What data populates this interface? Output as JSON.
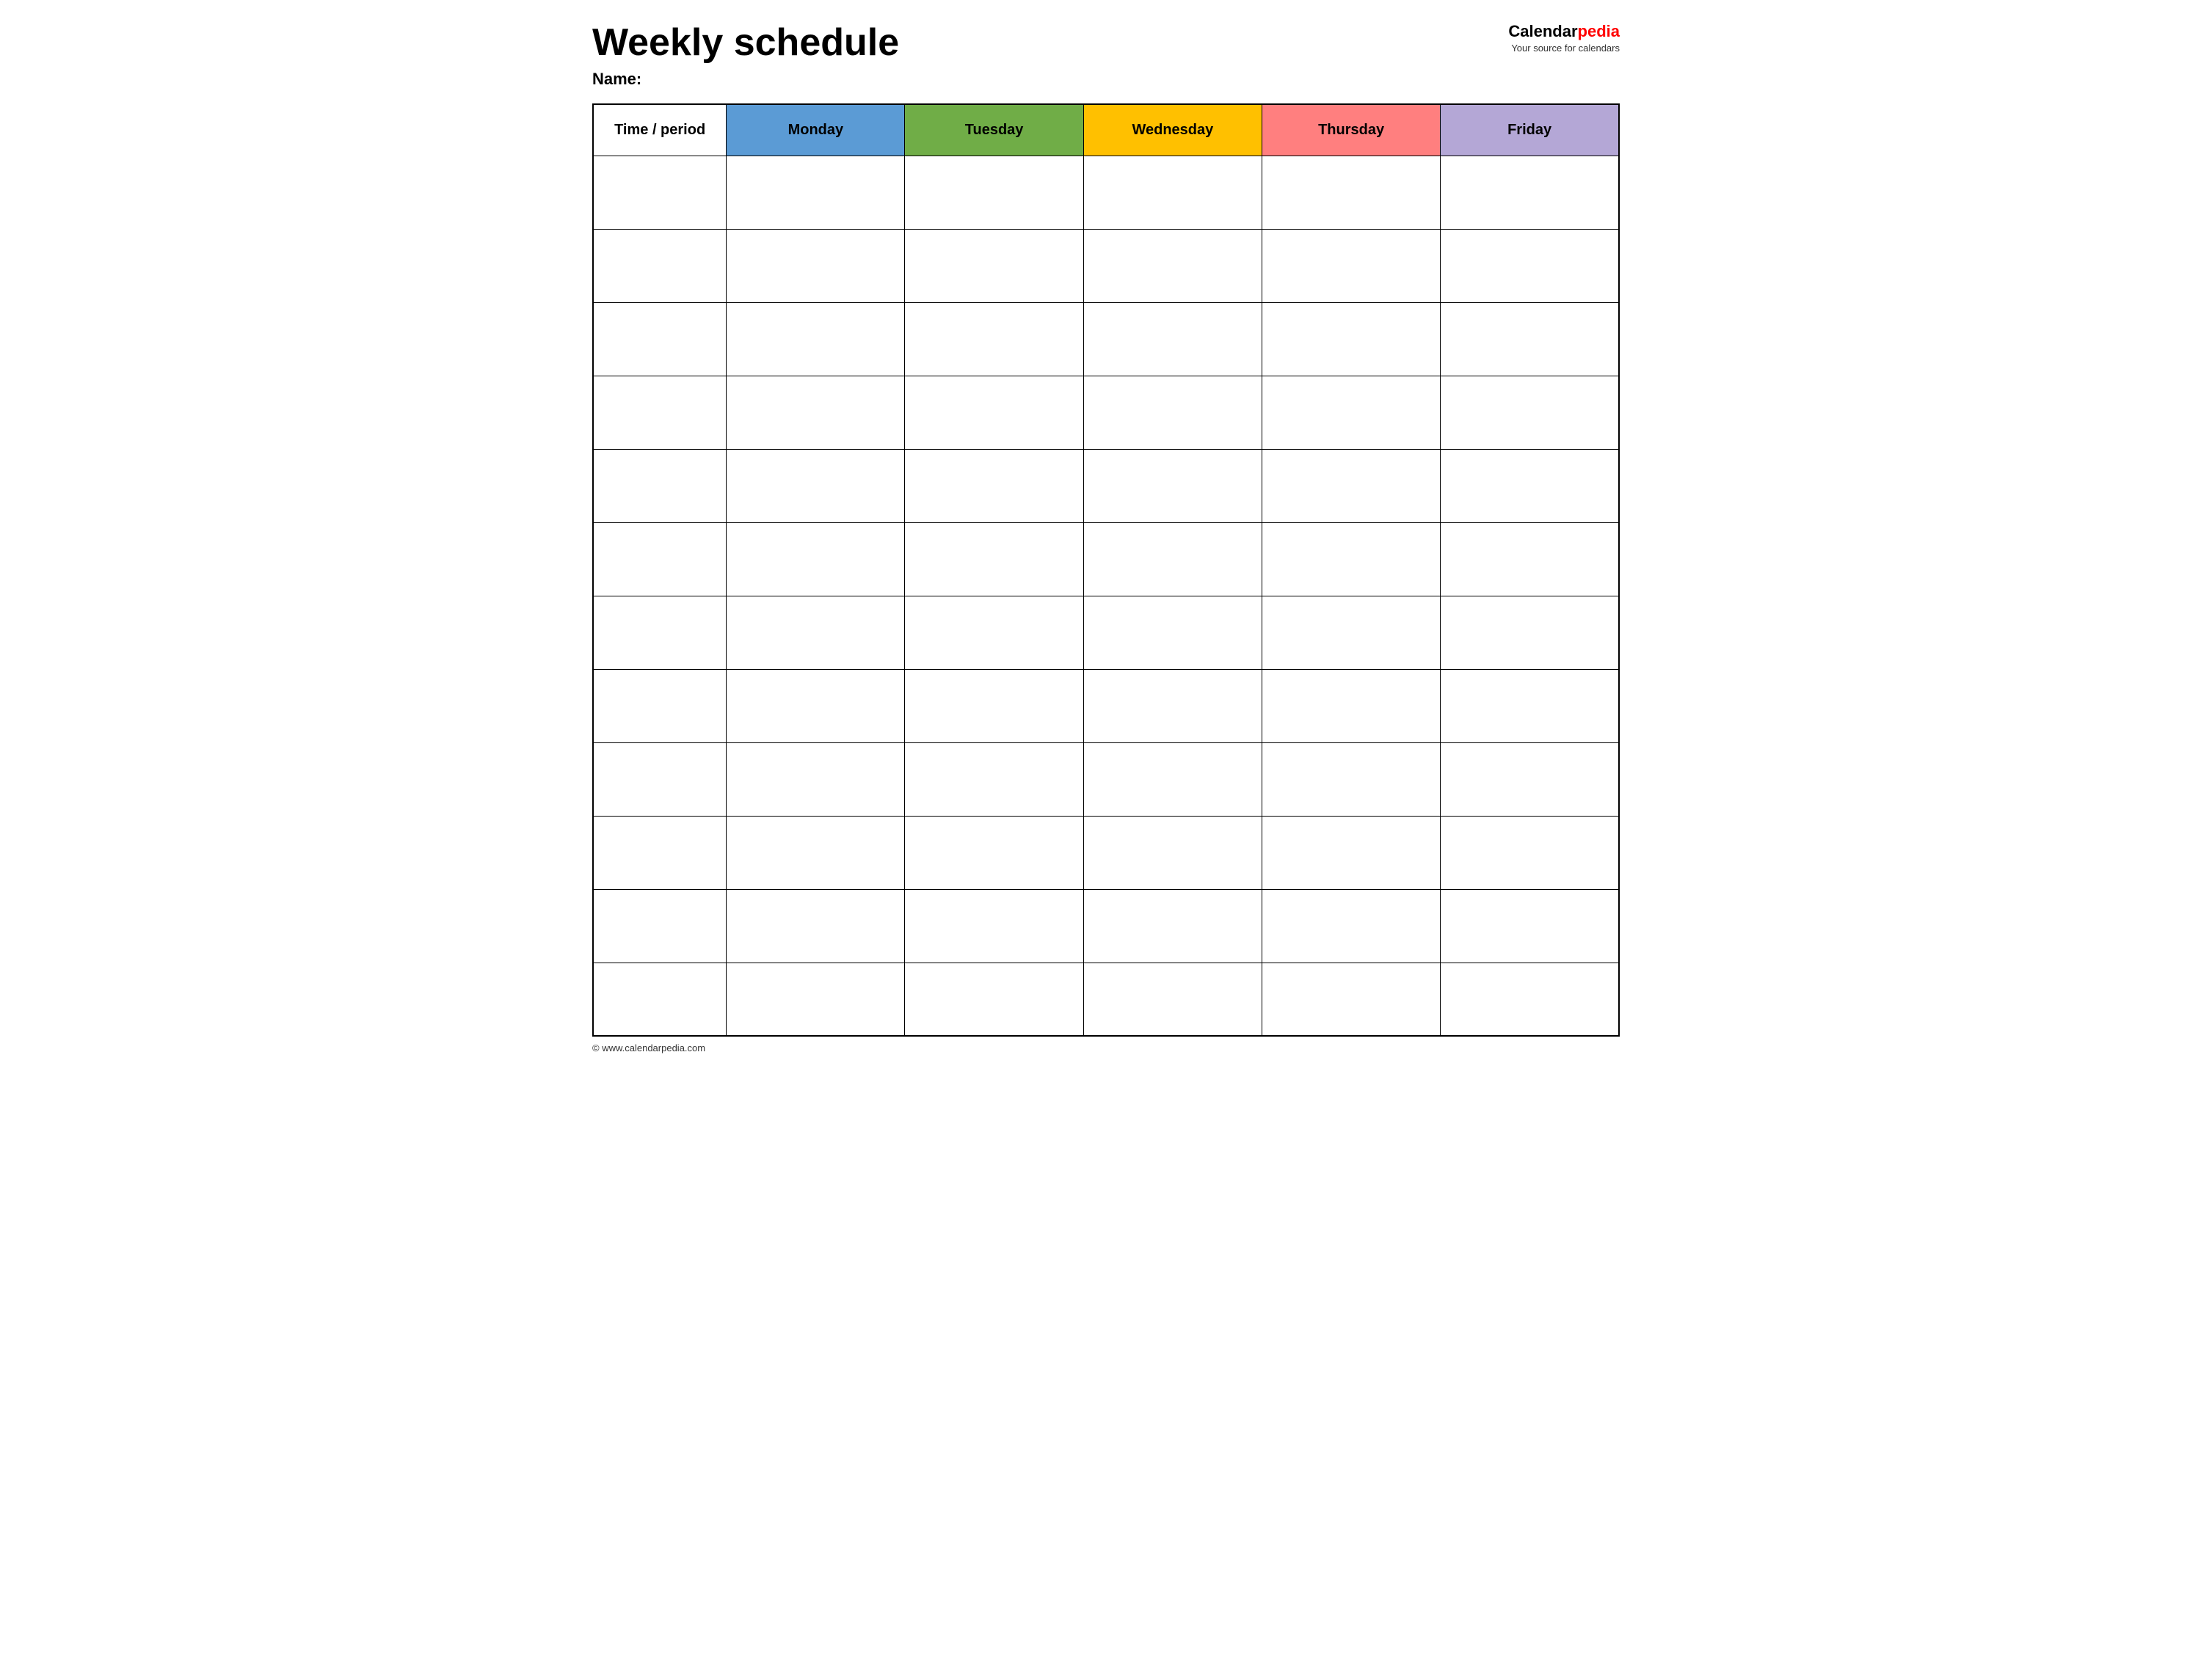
{
  "header": {
    "title": "Weekly schedule",
    "name_label": "Name:",
    "logo_calendar": "Calendar",
    "logo_pedia": "pedia",
    "logo_subtitle": "Your source for calendars"
  },
  "table": {
    "columns": [
      {
        "id": "time",
        "label": "Time / period",
        "color": "#ffffff"
      },
      {
        "id": "monday",
        "label": "Monday",
        "color": "#5b9bd5"
      },
      {
        "id": "tuesday",
        "label": "Tuesday",
        "color": "#70ad47"
      },
      {
        "id": "wednesday",
        "label": "Wednesday",
        "color": "#ffc000"
      },
      {
        "id": "thursday",
        "label": "Thursday",
        "color": "#ff7f7f"
      },
      {
        "id": "friday",
        "label": "Friday",
        "color": "#b4a7d6"
      }
    ],
    "row_count": 12
  },
  "footer": {
    "copyright": "© www.calendarpedia.com"
  }
}
